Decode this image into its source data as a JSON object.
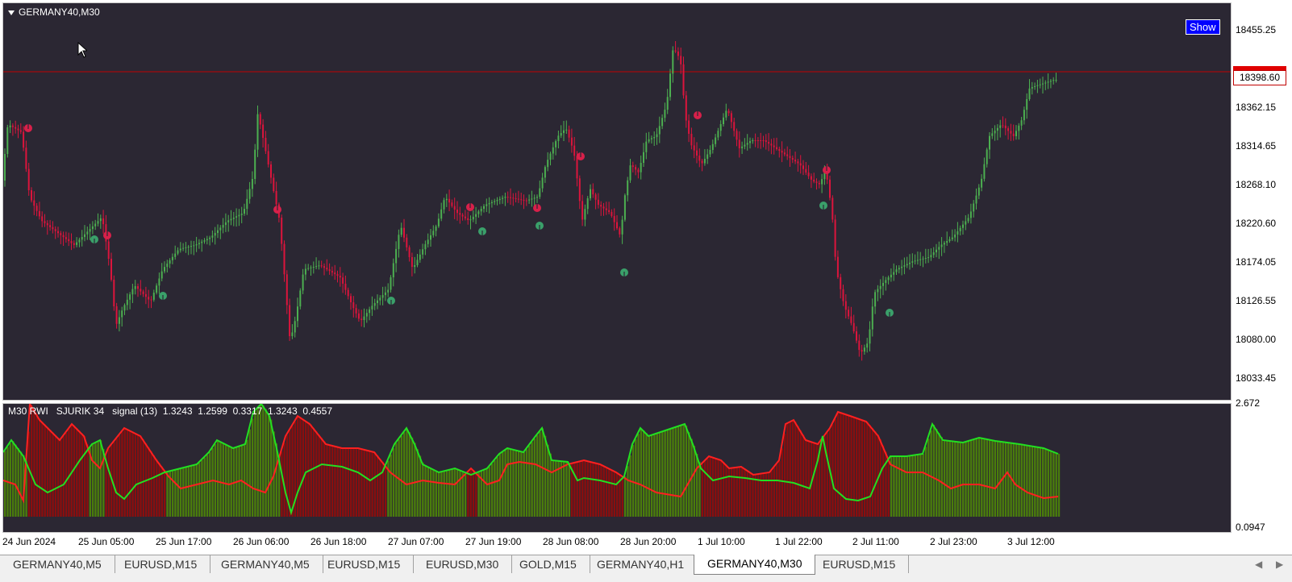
{
  "chart": {
    "title": "GERMANY40,M30",
    "show_button": "Show",
    "current_price": "18398.60",
    "price_ticks": [
      "18455.25",
      "18362.15",
      "18314.65",
      "18268.10",
      "18220.60",
      "18174.05",
      "18126.55",
      "18080.00",
      "18033.45"
    ],
    "time_ticks": [
      "24 Jun 2024",
      "25 Jun 05:00",
      "25 Jun 17:00",
      "26 Jun 06:00",
      "26 Jun 18:00",
      "27 Jun 07:00",
      "27 Jun 19:00",
      "28 Jun 08:00",
      "28 Jun 20:00",
      "1 Jul 10:00",
      "1 Jul 22:00",
      "2 Jul 11:00",
      "2 Jul 23:00",
      "3 Jul 12:00"
    ],
    "colors": {
      "background": "#2b2733",
      "bull": "#4caf50",
      "bear": "#dc143c",
      "price_line": "#c00000",
      "signal_up": "#3aa06a",
      "signal_down": "#d8204a"
    }
  },
  "indicator": {
    "label": "M30 RWI   SJURIK 34   signal (13)  1.3243  1.2599  0.3317  1.3243  0.4557",
    "scale_max": "2.672",
    "scale_min": "0.0947",
    "colors": {
      "up_fill": "#4a7d0c",
      "down_fill": "#8b0e0e",
      "up_line": "#22e022",
      "down_line": "#ff2020"
    }
  },
  "tabs": [
    {
      "label": "GERMANY40,M5",
      "active": false
    },
    {
      "label": "EURUSD,M15",
      "active": false
    },
    {
      "label": "GERMANY40,M5",
      "active": false
    },
    {
      "label": "EURUSD,M15",
      "active": false
    },
    {
      "label": "EURUSD,M30",
      "active": false
    },
    {
      "label": "GOLD,M15",
      "active": false
    },
    {
      "label": "GERMANY40,H1",
      "active": false
    },
    {
      "label": "GERMANY40,M30",
      "active": true
    },
    {
      "label": "EURUSD,M15",
      "active": false
    }
  ]
}
